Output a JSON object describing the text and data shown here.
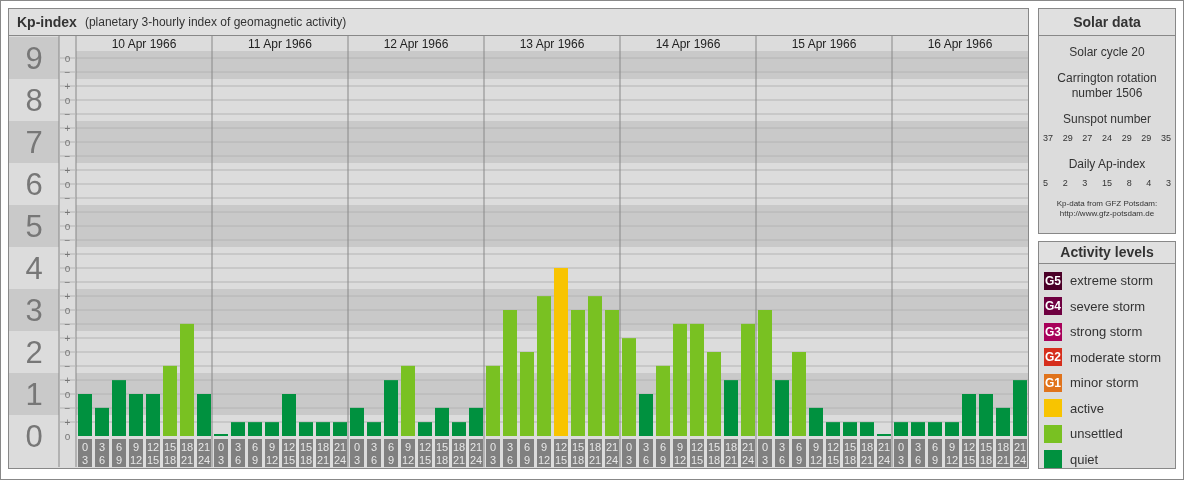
{
  "header": {
    "title": "Kp-index",
    "subtitle": "(planetary 3-hourly index of geomagnetic activity)"
  },
  "y_axis": [
    {
      "marks": [
        "o",
        "−"
      ]
    },
    {
      "marks": [
        "+",
        "o",
        "−"
      ]
    },
    {
      "marks": [
        "+",
        "o",
        "−"
      ]
    },
    {
      "marks": [
        "+",
        "o",
        "−"
      ]
    },
    {
      "marks": [
        "+",
        "o",
        "−"
      ]
    },
    {
      "marks": [
        "+",
        "o",
        "−"
      ]
    },
    {
      "marks": [
        "+",
        "o",
        "−"
      ]
    },
    {
      "marks": [
        "+",
        "o",
        "−"
      ]
    },
    {
      "marks": [
        "+",
        "o",
        "−"
      ]
    },
    {
      "marks": [
        "+",
        "o"
      ]
    }
  ],
  "days": [
    {
      "date": "10 Apr 1966",
      "slots": [
        [
          "0",
          "3"
        ],
        [
          "3",
          "6"
        ],
        [
          "6",
          "9"
        ],
        [
          "9",
          "12"
        ],
        [
          "12",
          "15"
        ],
        [
          "15",
          "18"
        ],
        [
          "18",
          "21"
        ],
        [
          "21",
          "24"
        ]
      ]
    },
    {
      "date": "11 Apr 1966",
      "slots": [
        [
          "0",
          "3"
        ],
        [
          "3",
          "6"
        ],
        [
          "6",
          "9"
        ],
        [
          "9",
          "12"
        ],
        [
          "12",
          "15"
        ],
        [
          "15",
          "18"
        ],
        [
          "18",
          "21"
        ],
        [
          "21",
          "24"
        ]
      ]
    },
    {
      "date": "12 Apr 1966",
      "slots": [
        [
          "0",
          "3"
        ],
        [
          "3",
          "6"
        ],
        [
          "6",
          "9"
        ],
        [
          "9",
          "12"
        ],
        [
          "12",
          "15"
        ],
        [
          "15",
          "18"
        ],
        [
          "18",
          "21"
        ],
        [
          "21",
          "24"
        ]
      ]
    },
    {
      "date": "13 Apr 1966",
      "slots": [
        [
          "0",
          "3"
        ],
        [
          "3",
          "6"
        ],
        [
          "6",
          "9"
        ],
        [
          "9",
          "12"
        ],
        [
          "12",
          "15"
        ],
        [
          "15",
          "18"
        ],
        [
          "18",
          "21"
        ],
        [
          "21",
          "24"
        ]
      ]
    },
    {
      "date": "14 Apr 1966",
      "slots": [
        [
          "0",
          "3"
        ],
        [
          "3",
          "6"
        ],
        [
          "6",
          "9"
        ],
        [
          "9",
          "12"
        ],
        [
          "12",
          "15"
        ],
        [
          "15",
          "18"
        ],
        [
          "18",
          "21"
        ],
        [
          "21",
          "24"
        ]
      ]
    },
    {
      "date": "15 Apr 1966",
      "slots": [
        [
          "0",
          "3"
        ],
        [
          "3",
          "6"
        ],
        [
          "6",
          "9"
        ],
        [
          "9",
          "12"
        ],
        [
          "12",
          "15"
        ],
        [
          "15",
          "18"
        ],
        [
          "18",
          "21"
        ],
        [
          "21",
          "24"
        ]
      ]
    },
    {
      "date": "16 Apr 1966",
      "slots": [
        [
          "0",
          "3"
        ],
        [
          "3",
          "6"
        ],
        [
          "6",
          "9"
        ],
        [
          "9",
          "12"
        ],
        [
          "12",
          "15"
        ],
        [
          "15",
          "18"
        ],
        [
          "18",
          "21"
        ],
        [
          "21",
          "24"
        ]
      ]
    }
  ],
  "chart_data": {
    "type": "bar",
    "grid": true,
    "ylim": [
      0,
      9
    ],
    "yticks": [
      {
        "value": 0,
        "label": "0"
      },
      {
        "value": 1,
        "label": "1"
      },
      {
        "value": 2,
        "label": "2"
      },
      {
        "value": 3,
        "label": "3"
      },
      {
        "value": 4,
        "label": "4"
      },
      {
        "value": 5,
        "label": "5"
      },
      {
        "value": 6,
        "label": "6"
      },
      {
        "value": 7,
        "label": "7"
      },
      {
        "value": 8,
        "label": "8"
      },
      {
        "value": 9,
        "label": "9"
      }
    ],
    "series": [
      {
        "color": "#00913f",
        "values": [
          1,
          0.67,
          1.33,
          1,
          1,
          null,
          null,
          1,
          0,
          0.33,
          0.33,
          0.33,
          1,
          0.33,
          0.33,
          0.33,
          0.67,
          0.33,
          1.33,
          null,
          0.33,
          0.67,
          0.33,
          0.67,
          null,
          null,
          null,
          null,
          null,
          null,
          null,
          null,
          null,
          1,
          null,
          null,
          null,
          null,
          1.33,
          null,
          null,
          1.33,
          null,
          0.67,
          0.33,
          0.33,
          0.33,
          0,
          0.33,
          0.33,
          0.33,
          0.33,
          1,
          1,
          0.67,
          1.33
        ]
      },
      {
        "color": "#79c122",
        "values": [
          null,
          null,
          null,
          null,
          null,
          1.67,
          2.67,
          null,
          null,
          null,
          null,
          null,
          null,
          null,
          null,
          null,
          null,
          null,
          null,
          1.67,
          null,
          null,
          null,
          null,
          1.67,
          3,
          2,
          3.33,
          null,
          3,
          3.33,
          3,
          2.33,
          null,
          1.67,
          2.67,
          2.67,
          2,
          null,
          2.67,
          3,
          null,
          2,
          null,
          null,
          null,
          null,
          null,
          null,
          null,
          null,
          null,
          null,
          null,
          null,
          null
        ]
      },
      {
        "color": "#f8c400",
        "values": [
          null,
          null,
          null,
          null,
          null,
          null,
          null,
          null,
          null,
          null,
          null,
          null,
          null,
          null,
          null,
          null,
          null,
          null,
          null,
          null,
          null,
          null,
          null,
          null,
          null,
          null,
          null,
          null,
          4,
          null,
          null,
          null,
          null,
          null,
          null,
          null,
          null,
          null,
          null,
          null,
          null,
          null,
          null,
          null,
          null,
          null,
          null,
          null,
          null,
          null,
          null,
          null,
          null,
          null,
          null,
          null
        ]
      }
    ]
  },
  "solar_data": {
    "title": "Solar data",
    "cycle": "Solar cycle 20",
    "rotation": "Carrington rotation number 1506",
    "sunspot_title": "Sunspot number",
    "sunspot_numbers": [
      "37",
      "29",
      "27",
      "24",
      "29",
      "29",
      "35"
    ],
    "ap_title": "Daily Ap-index",
    "ap_values": [
      "5",
      "2",
      "3",
      "15",
      "8",
      "4",
      "3"
    ],
    "source": "Kp-data from GFZ Potsdam:",
    "source_url": "http://www.gfz-potsdam.de"
  },
  "activity_levels": {
    "title": "Activity levels",
    "items": [
      {
        "badge": "G5",
        "label": "extreme storm",
        "color": "#4b0028"
      },
      {
        "badge": "G4",
        "label": "severe storm",
        "color": "#6e0040"
      },
      {
        "badge": "G3",
        "label": "strong storm",
        "color": "#a8005a"
      },
      {
        "badge": "G2",
        "label": "moderate storm",
        "color": "#d62e1c"
      },
      {
        "badge": "G1",
        "label": "minor storm",
        "color": "#e0731c"
      },
      {
        "label": "active",
        "color": "#f8c400"
      },
      {
        "label": "unsettled",
        "color": "#79c122"
      },
      {
        "label": "quiet",
        "color": "#00913f"
      }
    ]
  }
}
